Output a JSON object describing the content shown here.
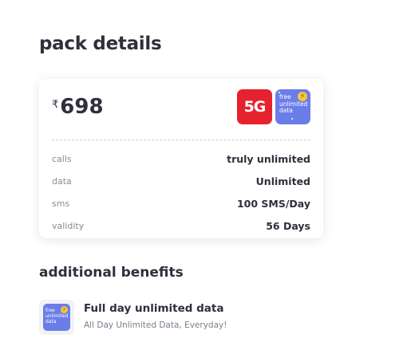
{
  "page": {
    "title": "pack details"
  },
  "pack": {
    "currency_symbol": "₹",
    "price": "698",
    "badges": {
      "fiveg": "5G",
      "free_line1": "free",
      "free_line2": "unlimited",
      "free_line3": "data"
    },
    "rows": [
      {
        "label": "calls",
        "value": "truly unlimited"
      },
      {
        "label": "data",
        "value": "Unlimited"
      },
      {
        "label": "sms",
        "value": "100 SMS/Day"
      },
      {
        "label": "validity",
        "value": "56 Days"
      }
    ]
  },
  "benefits": {
    "title": "additional benefits",
    "items": [
      {
        "icon_line1": "free",
        "icon_line2": "unlimited",
        "icon_line3": "data",
        "title": "Full day unlimited data",
        "description": "All Day Unlimited Data, Everyday!"
      }
    ]
  },
  "colors": {
    "fiveg_badge": "#e6222f",
    "free_data_badge": "#6b7de8",
    "bolt": "#f6c33a"
  }
}
